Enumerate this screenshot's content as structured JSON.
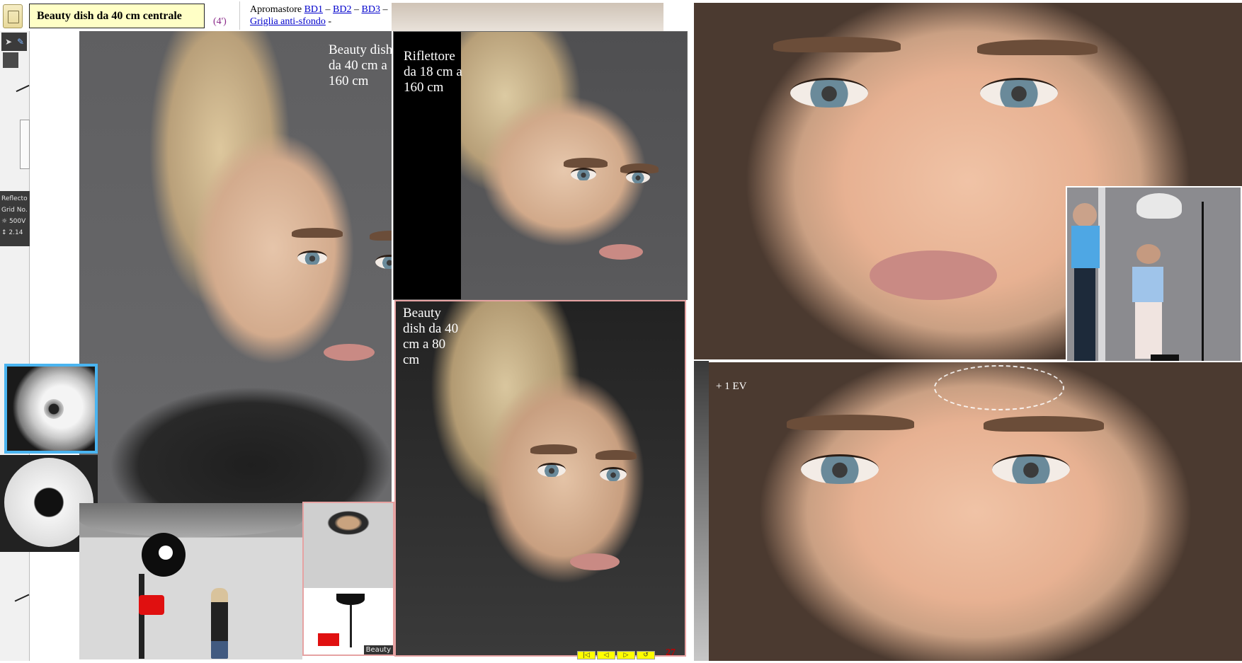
{
  "header": {
    "title": "Beauty dish da 40 cm centrale",
    "duration": "(4')",
    "store_label": "Apromastore",
    "links": [
      {
        "label": "BD1"
      },
      {
        "label": "BD2"
      },
      {
        "label": "BD3"
      },
      {
        "label": "Griglia anti-sfondo"
      }
    ],
    "sep": "–",
    "trailing": "-"
  },
  "toolbar": {
    "icons": [
      "select-arrow-icon",
      "pen-icon",
      "hand-icon"
    ]
  },
  "reflector_panel": {
    "title": "Reflecto",
    "grid": "Grid No.",
    "power": "500V",
    "distance": "2.14"
  },
  "photos": {
    "main_label": "Beauty dish da 40 cm a 160 cm",
    "top_right_label": "Riflettore da 18 cm a 160 cm",
    "bottom_label": "Beauty dish da 40 cm a 80 cm",
    "ev_label": "+ 1 EV",
    "small_thumb_label": "Beauty"
  },
  "nav": {
    "buttons": [
      "|◁",
      "◁",
      "▷",
      "↺"
    ],
    "page": "27"
  },
  "colors": {
    "title_bg": "#ffffc6",
    "duration": "#8a2a8a",
    "link": "#0000cc",
    "page_number": "#c00000",
    "nav_button": "#ffff00",
    "thumb_border": "#4ab4f0",
    "photo_border_pink": "#e6a2a2"
  }
}
